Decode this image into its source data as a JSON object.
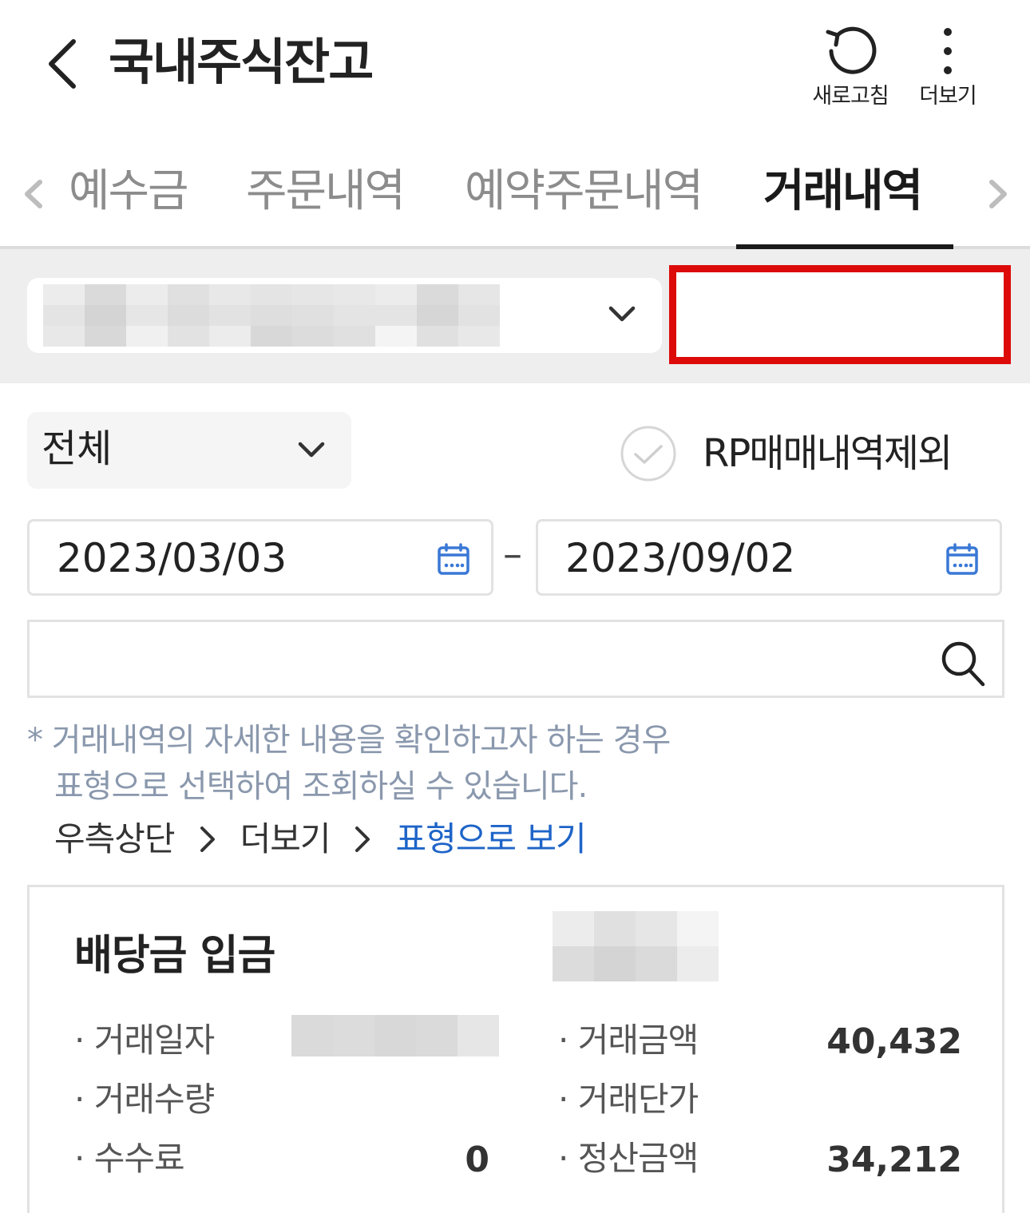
{
  "header": {
    "title": "국내주식잔고",
    "refresh_label": "새로고침",
    "more_label": "더보기"
  },
  "tabs": [
    {
      "label": "예수금",
      "active": false
    },
    {
      "label": "주문내역",
      "active": false
    },
    {
      "label": "예약주문내역",
      "active": false
    },
    {
      "label": "거래내역",
      "active": true
    }
  ],
  "filters": {
    "type_select": "전체",
    "rp_exclude_label": "RP매매내역제외",
    "start_date": "2023/03/03",
    "date_separator": "–",
    "end_date": "2023/09/02",
    "search_placeholder": ""
  },
  "notice": {
    "asterisk": "*",
    "line1": "거래내역의 자세한 내용을 확인하고자 하는 경우",
    "line2": "표형으로 선택하여 조회하실 수 있습니다.",
    "path1": "우측상단",
    "path2": "더보기",
    "path3": "표형으로 보기"
  },
  "transaction": {
    "title": "배당금 입금",
    "date_label": "· 거래일자",
    "quantity_label": "· 거래수량",
    "fee_label": "· 수수료",
    "fee_value": "0",
    "amount_label": "· 거래금액",
    "amount_value": "40,432",
    "unit_price_label": "· 거래단가",
    "settlement_label": "· 정산금액",
    "settlement_value": "34,212"
  },
  "colors": {
    "accent_link": "#1e64c8",
    "highlight_border": "#dd0a0a",
    "notice_text": "#8a98ad",
    "calendar_icon": "#3a78d6"
  }
}
